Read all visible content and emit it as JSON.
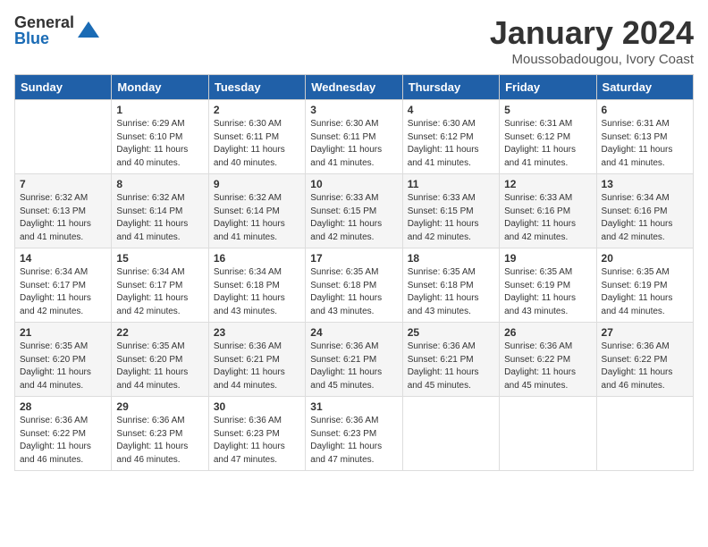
{
  "logo": {
    "general": "General",
    "blue": "Blue"
  },
  "title": "January 2024",
  "location": "Moussobadougou, Ivory Coast",
  "days_of_week": [
    "Sunday",
    "Monday",
    "Tuesday",
    "Wednesday",
    "Thursday",
    "Friday",
    "Saturday"
  ],
  "weeks": [
    [
      {
        "day": "",
        "info": ""
      },
      {
        "day": "1",
        "info": "Sunrise: 6:29 AM\nSunset: 6:10 PM\nDaylight: 11 hours\nand 40 minutes."
      },
      {
        "day": "2",
        "info": "Sunrise: 6:30 AM\nSunset: 6:11 PM\nDaylight: 11 hours\nand 40 minutes."
      },
      {
        "day": "3",
        "info": "Sunrise: 6:30 AM\nSunset: 6:11 PM\nDaylight: 11 hours\nand 41 minutes."
      },
      {
        "day": "4",
        "info": "Sunrise: 6:30 AM\nSunset: 6:12 PM\nDaylight: 11 hours\nand 41 minutes."
      },
      {
        "day": "5",
        "info": "Sunrise: 6:31 AM\nSunset: 6:12 PM\nDaylight: 11 hours\nand 41 minutes."
      },
      {
        "day": "6",
        "info": "Sunrise: 6:31 AM\nSunset: 6:13 PM\nDaylight: 11 hours\nand 41 minutes."
      }
    ],
    [
      {
        "day": "7",
        "info": "Sunrise: 6:32 AM\nSunset: 6:13 PM\nDaylight: 11 hours\nand 41 minutes."
      },
      {
        "day": "8",
        "info": "Sunrise: 6:32 AM\nSunset: 6:14 PM\nDaylight: 11 hours\nand 41 minutes."
      },
      {
        "day": "9",
        "info": "Sunrise: 6:32 AM\nSunset: 6:14 PM\nDaylight: 11 hours\nand 41 minutes."
      },
      {
        "day": "10",
        "info": "Sunrise: 6:33 AM\nSunset: 6:15 PM\nDaylight: 11 hours\nand 42 minutes."
      },
      {
        "day": "11",
        "info": "Sunrise: 6:33 AM\nSunset: 6:15 PM\nDaylight: 11 hours\nand 42 minutes."
      },
      {
        "day": "12",
        "info": "Sunrise: 6:33 AM\nSunset: 6:16 PM\nDaylight: 11 hours\nand 42 minutes."
      },
      {
        "day": "13",
        "info": "Sunrise: 6:34 AM\nSunset: 6:16 PM\nDaylight: 11 hours\nand 42 minutes."
      }
    ],
    [
      {
        "day": "14",
        "info": "Sunrise: 6:34 AM\nSunset: 6:17 PM\nDaylight: 11 hours\nand 42 minutes."
      },
      {
        "day": "15",
        "info": "Sunrise: 6:34 AM\nSunset: 6:17 PM\nDaylight: 11 hours\nand 42 minutes."
      },
      {
        "day": "16",
        "info": "Sunrise: 6:34 AM\nSunset: 6:18 PM\nDaylight: 11 hours\nand 43 minutes."
      },
      {
        "day": "17",
        "info": "Sunrise: 6:35 AM\nSunset: 6:18 PM\nDaylight: 11 hours\nand 43 minutes."
      },
      {
        "day": "18",
        "info": "Sunrise: 6:35 AM\nSunset: 6:18 PM\nDaylight: 11 hours\nand 43 minutes."
      },
      {
        "day": "19",
        "info": "Sunrise: 6:35 AM\nSunset: 6:19 PM\nDaylight: 11 hours\nand 43 minutes."
      },
      {
        "day": "20",
        "info": "Sunrise: 6:35 AM\nSunset: 6:19 PM\nDaylight: 11 hours\nand 44 minutes."
      }
    ],
    [
      {
        "day": "21",
        "info": "Sunrise: 6:35 AM\nSunset: 6:20 PM\nDaylight: 11 hours\nand 44 minutes."
      },
      {
        "day": "22",
        "info": "Sunrise: 6:35 AM\nSunset: 6:20 PM\nDaylight: 11 hours\nand 44 minutes."
      },
      {
        "day": "23",
        "info": "Sunrise: 6:36 AM\nSunset: 6:21 PM\nDaylight: 11 hours\nand 44 minutes."
      },
      {
        "day": "24",
        "info": "Sunrise: 6:36 AM\nSunset: 6:21 PM\nDaylight: 11 hours\nand 45 minutes."
      },
      {
        "day": "25",
        "info": "Sunrise: 6:36 AM\nSunset: 6:21 PM\nDaylight: 11 hours\nand 45 minutes."
      },
      {
        "day": "26",
        "info": "Sunrise: 6:36 AM\nSunset: 6:22 PM\nDaylight: 11 hours\nand 45 minutes."
      },
      {
        "day": "27",
        "info": "Sunrise: 6:36 AM\nSunset: 6:22 PM\nDaylight: 11 hours\nand 46 minutes."
      }
    ],
    [
      {
        "day": "28",
        "info": "Sunrise: 6:36 AM\nSunset: 6:22 PM\nDaylight: 11 hours\nand 46 minutes."
      },
      {
        "day": "29",
        "info": "Sunrise: 6:36 AM\nSunset: 6:23 PM\nDaylight: 11 hours\nand 46 minutes."
      },
      {
        "day": "30",
        "info": "Sunrise: 6:36 AM\nSunset: 6:23 PM\nDaylight: 11 hours\nand 47 minutes."
      },
      {
        "day": "31",
        "info": "Sunrise: 6:36 AM\nSunset: 6:23 PM\nDaylight: 11 hours\nand 47 minutes."
      },
      {
        "day": "",
        "info": ""
      },
      {
        "day": "",
        "info": ""
      },
      {
        "day": "",
        "info": ""
      }
    ]
  ]
}
